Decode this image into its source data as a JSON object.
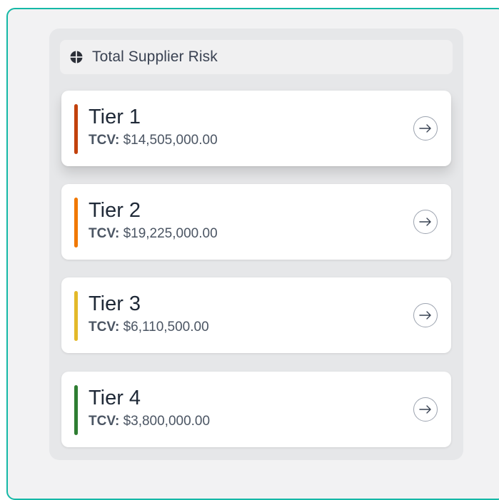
{
  "header": {
    "title": "Total Supplier Risk",
    "icon": "globe-icon"
  },
  "tiers": [
    {
      "label": "Tier 1",
      "tcv_label": "TCV:",
      "tcv_value": "$14,505,000.00",
      "color": "#c2410c"
    },
    {
      "label": "Tier 2",
      "tcv_label": "TCV:",
      "tcv_value": "$19,225,000.00",
      "color": "#f07800"
    },
    {
      "label": "Tier 3",
      "tcv_label": "TCV:",
      "tcv_value": "$6,110,500.00",
      "color": "#e3b92a"
    },
    {
      "label": "Tier 4",
      "tcv_label": "TCV:",
      "tcv_value": "$3,800,000.00",
      "color": "#2e7d32"
    }
  ],
  "colors": {
    "frame_border": "#14b8a6",
    "panel_bg": "#e6e7e9",
    "card_bg": "#ffffff"
  }
}
